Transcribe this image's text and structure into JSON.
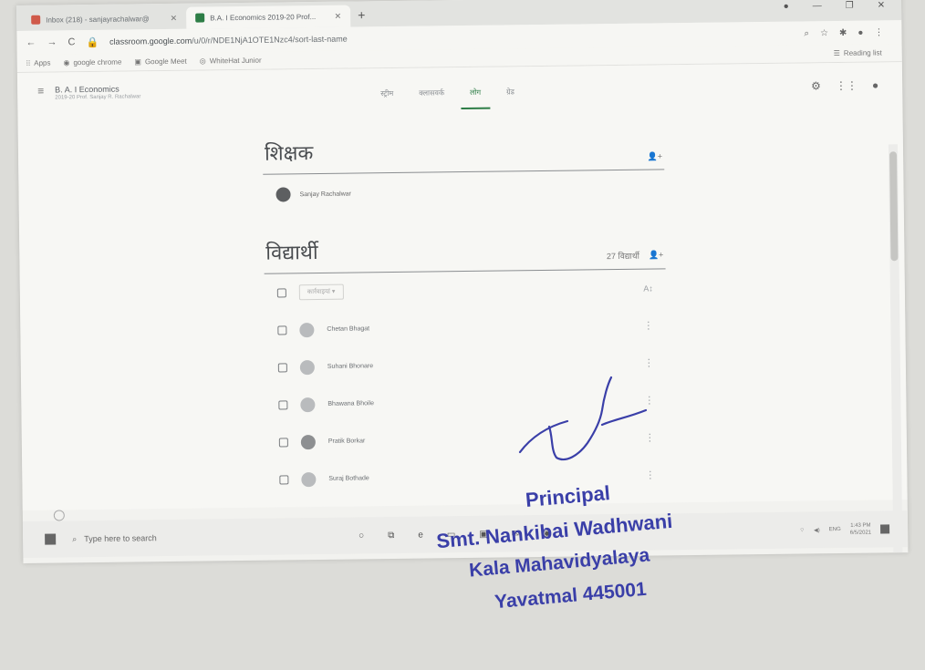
{
  "browser": {
    "tabs": [
      {
        "label": "Inbox (218) - sanjayrachalwar@",
        "favicon": "gmail-icon",
        "active": false
      },
      {
        "label": "B.A. I Economics 2019-20 Prof...",
        "favicon": "classroom-icon",
        "active": true
      }
    ],
    "new_tab": "+",
    "url_host": "classroom.google.com",
    "url_path": "/u/0/r/NDE1NjA1OTE1Nzc4/sort-last-name",
    "bookmarks": [
      "Apps",
      "google chrome",
      "Google Meet",
      "WhiteHat Junior"
    ],
    "reading_list": "Reading list"
  },
  "classroom": {
    "class_name": "B. A. I Economics",
    "class_subtitle": "2019-20 Prof. Sanjay R. Rachalwar",
    "nav_tabs": [
      "स्ट्रीम",
      "क्लासवर्क",
      "लोग",
      "ग्रेड"
    ],
    "active_tab_index": 2
  },
  "teachers": {
    "heading": "शिक्षक",
    "list": [
      {
        "name": "Sanjay Rachalwar"
      }
    ]
  },
  "students": {
    "heading": "विद्यार्थी",
    "count_label": "27 विद्यार्थी",
    "actions_label": "कार्रवाइयां",
    "list": [
      {
        "name": "Chetan Bhagat"
      },
      {
        "name": "Suhani Bhonare"
      },
      {
        "name": "Bhawana Bhoile"
      },
      {
        "name": "Pratik Borkar"
      },
      {
        "name": "Suraj Bothade"
      }
    ]
  },
  "taskbar": {
    "search_placeholder": "Type here to search",
    "time": "1:43 PM",
    "date": "6/5/2021",
    "lang": "ENG"
  },
  "stamp": {
    "line1": "Principal",
    "line2": "Smt. Nankibai Wadhwani",
    "line3": "Kala Mahavidyalaya",
    "line4": "Yavatmal 445001",
    "ink_color": "#3a3fa8"
  },
  "colors": {
    "classroom_green": "#2d7d46",
    "gmail_red": "#d05a4a"
  }
}
